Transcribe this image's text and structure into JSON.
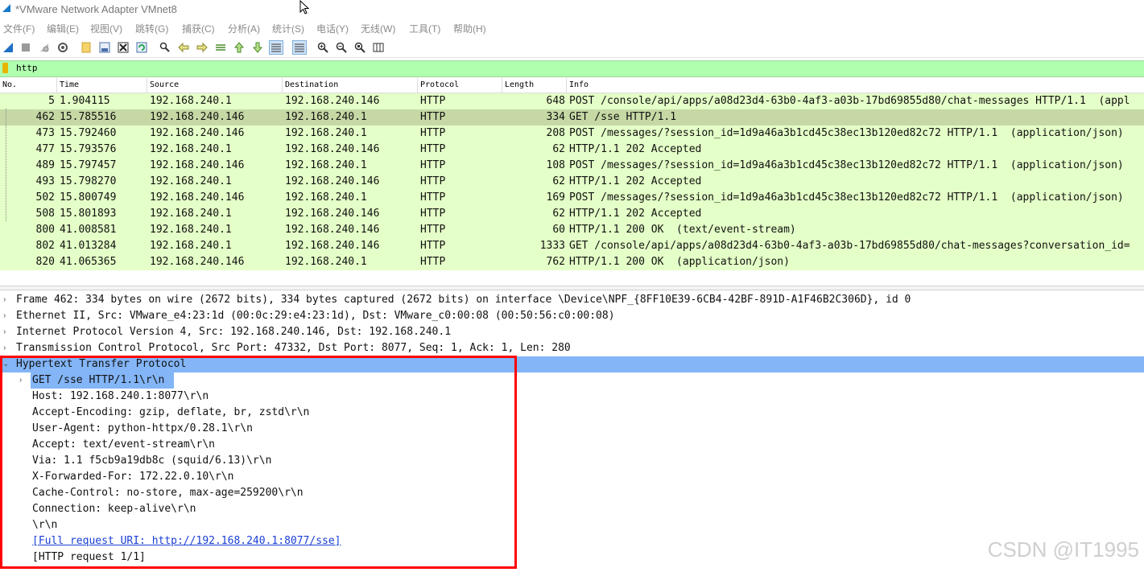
{
  "window": {
    "title": "*VMware Network Adapter VMnet8"
  },
  "menu": [
    "文件(F)",
    "编辑(E)",
    "视图(V)",
    "跳转(G)",
    "捕获(C)",
    "分析(A)",
    "统计(S)",
    "电话(Y)",
    "无线(W)",
    "工具(T)",
    "帮助(H)"
  ],
  "toolbar": {
    "icons": [
      "shark-fin-start-icon",
      "stop-capture-icon",
      "restart-capture-icon",
      "capture-options-icon",
      "open-file-icon",
      "save-file-icon",
      "close-file-icon",
      "reload-file-icon",
      "find-packet-icon",
      "go-back-icon",
      "go-forward-icon",
      "go-to-packet-icon",
      "go-first-icon",
      "go-last-icon",
      "auto-scroll-icon",
      "colorize-icon",
      "zoom-in-icon",
      "zoom-out-icon",
      "zoom-normal-icon",
      "resize-columns-icon"
    ]
  },
  "filter": {
    "value": "http"
  },
  "colors": {
    "row_bg": "#e4ffc7",
    "row_selected": "#c6d9a5",
    "detail_highlight": "#83b5f7",
    "filter_bg": "#afffaf",
    "annotation": "#ff0000"
  },
  "columns": [
    "No.",
    "Time",
    "Source",
    "Destination",
    "Protocol",
    "Length",
    "Info"
  ],
  "packets": [
    {
      "no": "5",
      "time": "1.904115",
      "src": "192.168.240.1",
      "dst": "192.168.240.146",
      "proto": "HTTP",
      "len": "648",
      "info": "POST /console/api/apps/a08d23d4-63b0-4af3-a03b-17bd69855d80/chat-messages HTTP/1.1  (appl"
    },
    {
      "no": "462",
      "time": "15.785516",
      "src": "192.168.240.146",
      "dst": "192.168.240.1",
      "proto": "HTTP",
      "len": "334",
      "info": "GET /sse HTTP/1.1"
    },
    {
      "no": "473",
      "time": "15.792460",
      "src": "192.168.240.146",
      "dst": "192.168.240.1",
      "proto": "HTTP",
      "len": "208",
      "info": "POST /messages/?session_id=1d9a46a3b1cd45c38ec13b120ed82c72 HTTP/1.1  (application/json)"
    },
    {
      "no": "477",
      "time": "15.793576",
      "src": "192.168.240.1",
      "dst": "192.168.240.146",
      "proto": "HTTP",
      "len": "62",
      "info": "HTTP/1.1 202 Accepted"
    },
    {
      "no": "489",
      "time": "15.797457",
      "src": "192.168.240.146",
      "dst": "192.168.240.1",
      "proto": "HTTP",
      "len": "108",
      "info": "POST /messages/?session_id=1d9a46a3b1cd45c38ec13b120ed82c72 HTTP/1.1  (application/json)"
    },
    {
      "no": "493",
      "time": "15.798270",
      "src": "192.168.240.1",
      "dst": "192.168.240.146",
      "proto": "HTTP",
      "len": "62",
      "info": "HTTP/1.1 202 Accepted"
    },
    {
      "no": "502",
      "time": "15.800749",
      "src": "192.168.240.146",
      "dst": "192.168.240.1",
      "proto": "HTTP",
      "len": "169",
      "info": "POST /messages/?session_id=1d9a46a3b1cd45c38ec13b120ed82c72 HTTP/1.1  (application/json)"
    },
    {
      "no": "508",
      "time": "15.801893",
      "src": "192.168.240.1",
      "dst": "192.168.240.146",
      "proto": "HTTP",
      "len": "62",
      "info": "HTTP/1.1 202 Accepted"
    },
    {
      "no": "800",
      "time": "41.008581",
      "src": "192.168.240.1",
      "dst": "192.168.240.146",
      "proto": "HTTP",
      "len": "60",
      "info": "HTTP/1.1 200 OK  (text/event-stream)"
    },
    {
      "no": "802",
      "time": "41.013284",
      "src": "192.168.240.1",
      "dst": "192.168.240.146",
      "proto": "HTTP",
      "len": "1333",
      "info": "GET /console/api/apps/a08d23d4-63b0-4af3-a03b-17bd69855d80/chat-messages?conversation_id="
    },
    {
      "no": "820",
      "time": "41.065365",
      "src": "192.168.240.146",
      "dst": "192.168.240.1",
      "proto": "HTTP",
      "len": "762",
      "info": "HTTP/1.1 200 OK  (application/json)"
    }
  ],
  "details": {
    "top": [
      "Frame 462: 334 bytes on wire (2672 bits), 334 bytes captured (2672 bits) on interface \\Device\\NPF_{8FF10E39-6CB4-42BF-891D-A1F46B2C306D}, id 0",
      "Ethernet II, Src: VMware_e4:23:1d (00:0c:29:e4:23:1d), Dst: VMware_c0:00:08 (00:50:56:c0:00:08)",
      "Internet Protocol Version 4, Src: 192.168.240.146, Dst: 192.168.240.1",
      "Transmission Control Protocol, Src Port: 47332, Dst Port: 8077, Seq: 1, Ack: 1, Len: 280"
    ],
    "http_header": "Hypertext Transfer Protocol",
    "request_line": "GET /sse HTTP/1.1\\r\\n",
    "fields": [
      "Host: 192.168.240.1:8077\\r\\n",
      "Accept-Encoding: gzip, deflate, br, zstd\\r\\n",
      "User-Agent: python-httpx/0.28.1\\r\\n",
      "Accept: text/event-stream\\r\\n",
      "Via: 1.1 f5cb9a19db8c (squid/6.13)\\r\\n",
      "X-Forwarded-For: 172.22.0.10\\r\\n",
      "Cache-Control: no-store, max-age=259200\\r\\n",
      "Connection: keep-alive\\r\\n",
      "\\r\\n"
    ],
    "full_uri": "[Full request URI: http://192.168.240.1:8077/sse]",
    "request_count": "[HTTP request 1/1]"
  },
  "watermark": "CSDN @IT1995"
}
